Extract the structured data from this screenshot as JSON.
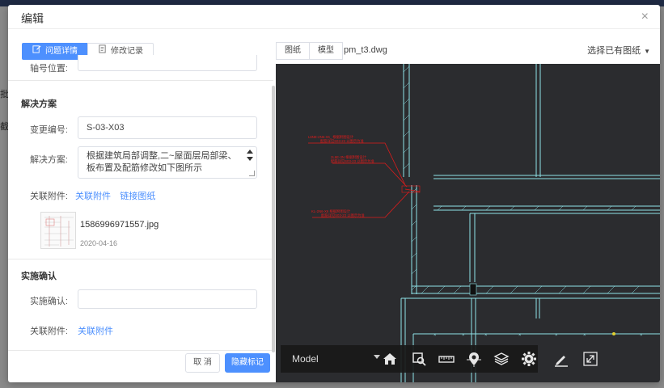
{
  "background": {
    "text_1": "批",
    "text_2": "截"
  },
  "modal": {
    "title": "编辑",
    "close_glyph": "×"
  },
  "left": {
    "tabs": [
      {
        "label": "问题详情",
        "icon": "edit-icon"
      },
      {
        "label": "修改记录",
        "icon": "document-icon"
      }
    ],
    "axis_label": "轴号位置:",
    "section_solution": "解决方案",
    "change_no_label": "变更编号:",
    "change_no_value": "S-03-X03",
    "solution_label": "解决方案:",
    "solution_value": "根据建筑局部调整,二~屋面层局部梁、板布置及配筋修改如下图所示",
    "attach_label": "关联附件:",
    "attach_link": "关联附件",
    "link_drawing": "链接图纸",
    "attachment": {
      "filename": "1586996971557.jpg",
      "date": "2020-04-16"
    },
    "section_confirm": "实施确认",
    "confirm_label": "实施确认:",
    "confirm_value": "",
    "attach_label_2": "关联附件:",
    "attach_link_2": "关联附件",
    "cancel_button": "取 消",
    "primary_button": "隐藏标记"
  },
  "right": {
    "tabs": [
      "图纸",
      "模型"
    ],
    "filename": "pm_t3.dwg",
    "select_drawing": "选择已有图纸",
    "toolbar": {
      "model_label": "Model",
      "icons": [
        "home-icon",
        "zoom-window-icon",
        "measure-icon",
        "locate-icon",
        "layers-icon",
        "settings-icon",
        "markup-pen-icon",
        "fullscreen-icon"
      ]
    },
    "annotations": [
      {
        "line1": "L6NE-2N6-X6_ 根据附图设计",
        "line2": "配筋详见S03-23 以图示为准"
      },
      {
        "line1": "2L6E-3N 根据附图设计",
        "line2": "配筋详见S03-23 以图示为准"
      },
      {
        "line1": "KL-2N6-X6 根据附图设计",
        "line2": "配筋详见S03-23 以图示为准"
      }
    ],
    "colors": {
      "cad_bg": "#2b2c2f",
      "cad_line": "#8fe3e8",
      "markup": "#e01b1b"
    }
  }
}
